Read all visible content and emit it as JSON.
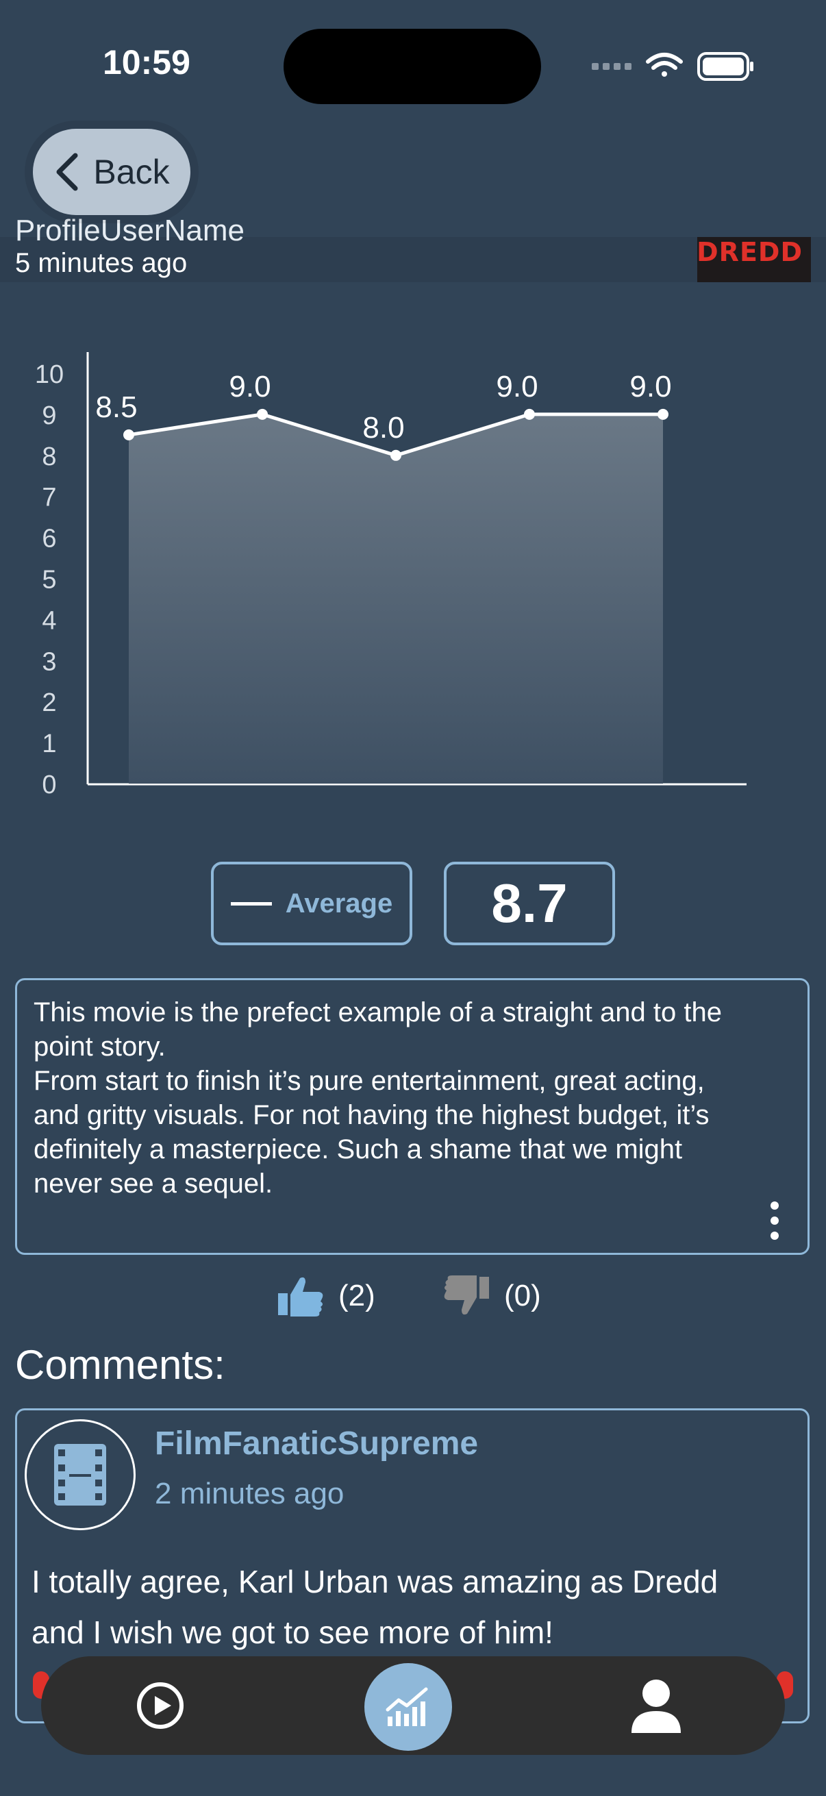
{
  "status_bar": {
    "time": "10:59"
  },
  "nav": {
    "back_label": "Back"
  },
  "review": {
    "reviewer_partial": "ProfileUserName",
    "time_ago": "5 minutes ago",
    "poster_title": "DREDD",
    "average_label": "Average",
    "average_value": "8.7",
    "text_lines": [
      "This movie is the prefect example of a straight and to the",
      "point story.",
      "From start to finish it’s pure entertainment, great acting,",
      "and gritty visuals. For not having the highest budget, it’s",
      "definitely a masterpiece. Such a shame that we might",
      "never see a sequel."
    ],
    "likes": "(2)",
    "dislikes": "(0)"
  },
  "comments": {
    "title": "Comments:",
    "items": [
      {
        "user": "FilmFanaticSupreme",
        "time_ago": "2 minutes ago",
        "lines": [
          "I totally agree, Karl Urban was amazing as Dredd",
          "and I wish we got to see more of him!"
        ]
      }
    ]
  },
  "colors": {
    "background": "#314457",
    "accent": "#8fb8d9",
    "tabbar": "#2e2e2e",
    "like_active": "#7fb6e0",
    "dislike_inactive": "#8a8a8a"
  },
  "icons": [
    "back-chevron-icon",
    "thumbs-up-icon",
    "thumbs-down-icon",
    "more-vertical-icon",
    "film-icon",
    "play-icon",
    "chart-icon",
    "person-icon",
    "wifi-icon",
    "battery-icon"
  ],
  "chart_data": {
    "type": "area",
    "y_ticks": [
      "0",
      "1",
      "2",
      "3",
      "4",
      "5",
      "6",
      "7",
      "8",
      "9",
      "10"
    ],
    "ylim": [
      0,
      10
    ],
    "values": [
      8.5,
      9.0,
      8.0,
      9.0,
      9.0
    ],
    "value_labels": [
      "8.5",
      "9.0",
      "8.0",
      "9.0",
      "9.0"
    ],
    "grid": false,
    "legend": "none"
  }
}
